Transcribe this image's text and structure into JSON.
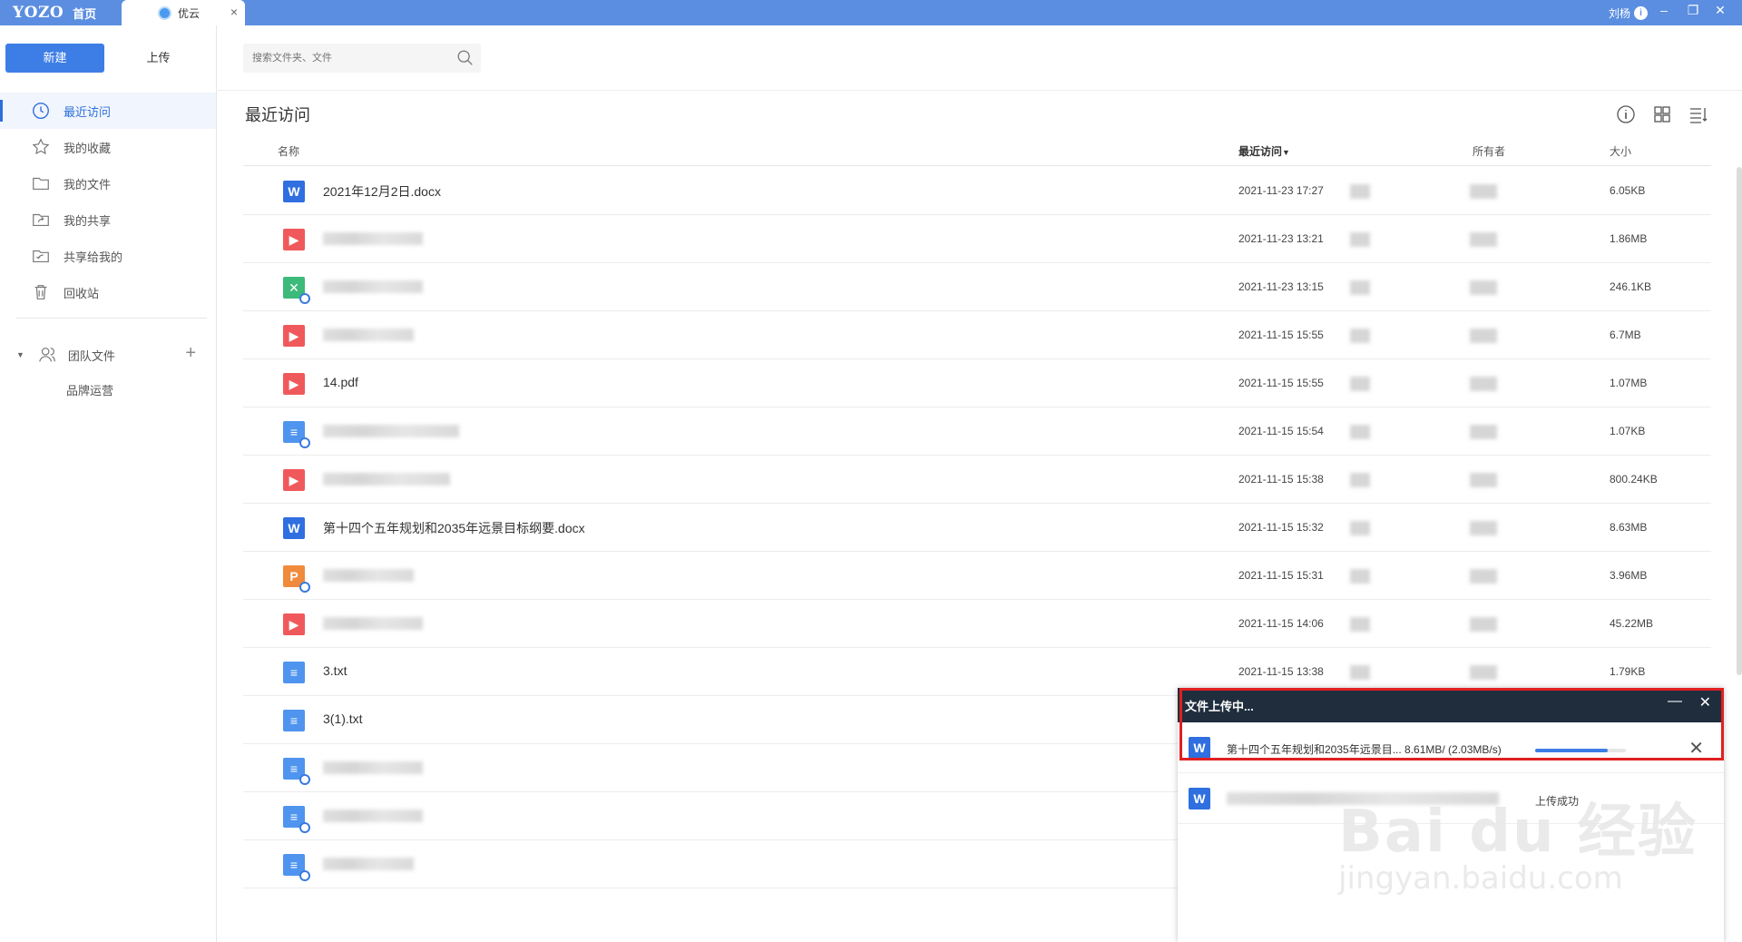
{
  "app": {
    "logo": "YOZO",
    "home_tab": "首页",
    "active_tab": "优云",
    "user_name": "刘杨"
  },
  "sidebar": {
    "new_button": "新建",
    "upload_button": "上传",
    "items": [
      {
        "label": "最近访问",
        "icon": "clock-icon",
        "active": true
      },
      {
        "label": "我的收藏",
        "icon": "star-icon"
      },
      {
        "label": "我的文件",
        "icon": "folder-icon"
      },
      {
        "label": "我的共享",
        "icon": "share-out-icon"
      },
      {
        "label": "共享给我的",
        "icon": "share-in-icon"
      },
      {
        "label": "回收站",
        "icon": "trash-icon"
      }
    ],
    "team": {
      "label": "团队文件",
      "sub_item": "品牌运营"
    }
  },
  "search": {
    "placeholder": "搜索文件夹、文件"
  },
  "main": {
    "title": "最近访问",
    "columns": {
      "name": "名称",
      "recent": "最近访问",
      "owner": "所有者",
      "size": "大小"
    },
    "files": [
      {
        "type": "word",
        "name": "2021年12月2日.docx",
        "date": "2021-11-23 17:27",
        "size": "6.05KB"
      },
      {
        "type": "pdf",
        "name": "",
        "date": "2021-11-23 13:21",
        "size": "1.86MB"
      },
      {
        "type": "excel",
        "name": "",
        "date": "2021-11-23 13:15",
        "size": "246.1KB"
      },
      {
        "type": "pdf",
        "name": "",
        "date": "2021-11-15 15:55",
        "size": "6.7MB"
      },
      {
        "type": "pdf",
        "name": "14.pdf",
        "date": "2021-11-15 15:55",
        "size": "1.07MB"
      },
      {
        "type": "txt",
        "name": "",
        "date": "2021-11-15 15:54",
        "size": "1.07KB"
      },
      {
        "type": "pdf",
        "name": "",
        "date": "2021-11-15 15:38",
        "size": "800.24KB"
      },
      {
        "type": "word",
        "name": "第十四个五年规划和2035年远景目标纲要.docx",
        "date": "2021-11-15 15:32",
        "size": "8.63MB"
      },
      {
        "type": "ppt",
        "name": "",
        "date": "2021-11-15 15:31",
        "size": "3.96MB"
      },
      {
        "type": "pdf",
        "name": "",
        "date": "2021-11-15 14:06",
        "size": "45.22MB"
      },
      {
        "type": "txt",
        "name": "3.txt",
        "date": "2021-11-15 13:38",
        "size": "1.79KB"
      },
      {
        "type": "txt",
        "name": "3(1).txt",
        "date": "",
        "size": ""
      },
      {
        "type": "txt",
        "name": "",
        "date": "",
        "size": ""
      },
      {
        "type": "txt",
        "name": "",
        "date": "",
        "size": ""
      },
      {
        "type": "txt",
        "name": "",
        "date": "",
        "size": ""
      }
    ]
  },
  "upload_panel": {
    "title": "文件上传中...",
    "items": [
      {
        "name": "第十四个五年规划和2035年远景目... 8.61MB/ (2.03MB/s)",
        "progress": 0.8
      },
      {
        "name": "",
        "status": "上传成功"
      }
    ]
  },
  "watermark": {
    "brand": "Bai du 经验",
    "url": "jingyan.baidu.com"
  },
  "colors": {
    "titlebar": "#5b8ee0",
    "primary": "#3d7ee6",
    "word": "#2f6fe0",
    "pdf": "#f0595b",
    "excel": "#3cba7a",
    "ppt": "#f08a3c",
    "txt": "#4f94ee"
  }
}
